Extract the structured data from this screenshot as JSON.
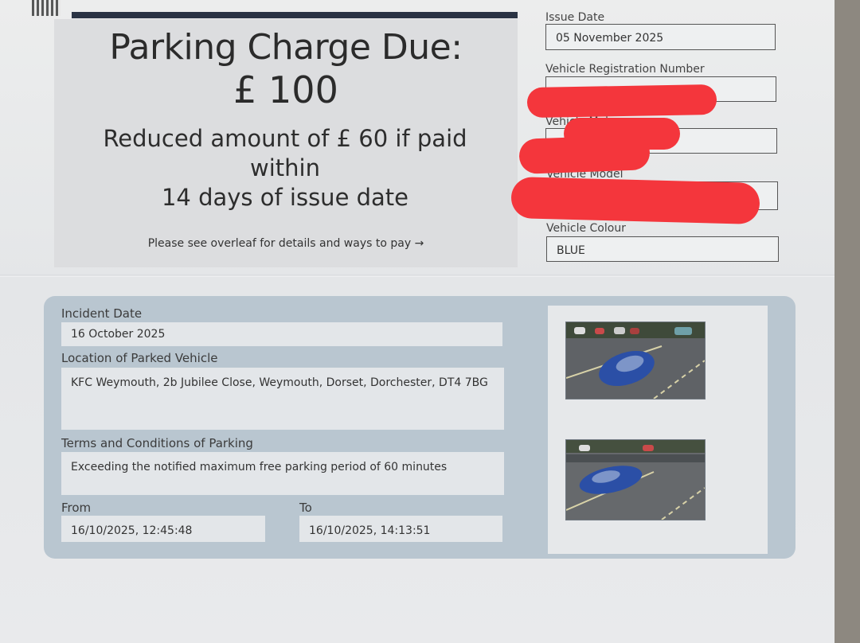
{
  "charge": {
    "title": "Parking Charge Due:",
    "amount": "£ 100",
    "reduced_line1": "Reduced amount of £ 60 if paid within",
    "reduced_line2": "14 days of issue date",
    "overleaf": "Please see overleaf for details and ways to pay →"
  },
  "vehicle": {
    "issue_date_label": "Issue Date",
    "issue_date": "05 November 2025",
    "registration_label": "Vehicle Registration Number",
    "make_label": "Vehicle Make",
    "model_label": "Vehicle Model",
    "colour_label": "Vehicle Colour",
    "colour": "BLUE"
  },
  "incident": {
    "date_label": "Incident Date",
    "date": "16 October 2025",
    "location_label": "Location of Parked Vehicle",
    "location": "KFC Weymouth, 2b Jubilee Close, Weymouth, Dorset, Dorchester, DT4 7BG",
    "terms_label": "Terms and Conditions of Parking",
    "terms": "Exceeding the notified maximum free parking period of 60 minutes",
    "from_label": "From",
    "from": "16/10/2025, 12:45:48",
    "to_label": "To",
    "to": "16/10/2025, 14:13:51"
  },
  "colors": {
    "redaction": "#f4363c",
    "panel": "#b9c6d0",
    "car": "#2b4fa6"
  }
}
